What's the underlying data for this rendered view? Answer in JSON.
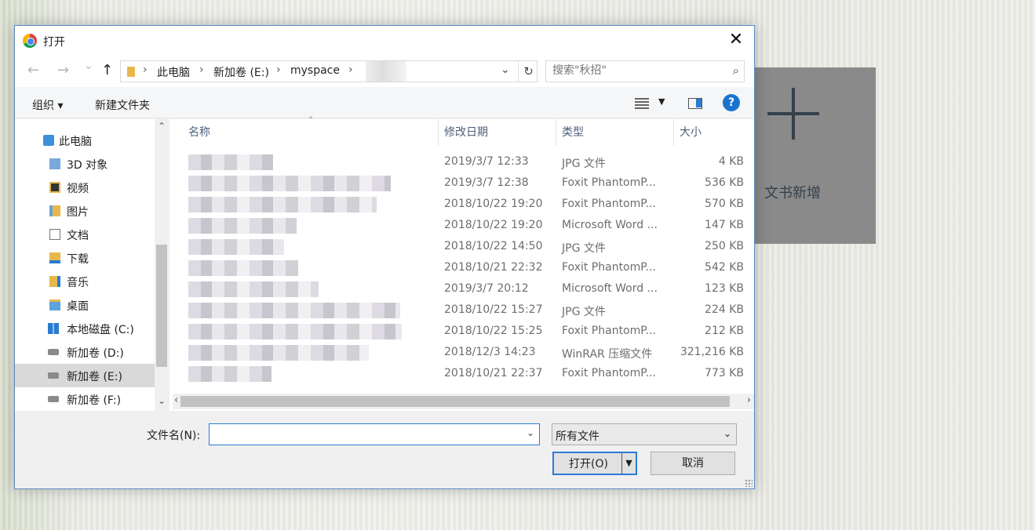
{
  "background_card": {
    "label": "文书新增",
    "icon": "plus-icon"
  },
  "dialog": {
    "title": "打开",
    "title_icon": "chrome-icon",
    "nav": {
      "back": "←",
      "forward": "→",
      "recent": "⌄",
      "up": "↑",
      "breadcrumb": [
        "此电脑",
        "新加卷 (E:)",
        "myspace"
      ],
      "separator": "›",
      "search_placeholder": "搜索\"秋招\""
    },
    "toolbar": {
      "organize": "组织 ▾",
      "new_folder": "新建文件夹"
    },
    "tree": [
      {
        "label": "此电脑",
        "icon": "computer-icon"
      },
      {
        "label": "3D 对象",
        "icon": "3d-objects-icon"
      },
      {
        "label": "视频",
        "icon": "video-folder-icon"
      },
      {
        "label": "图片",
        "icon": "pictures-folder-icon"
      },
      {
        "label": "文档",
        "icon": "documents-folder-icon"
      },
      {
        "label": "下载",
        "icon": "downloads-folder-icon"
      },
      {
        "label": "音乐",
        "icon": "music-folder-icon"
      },
      {
        "label": "桌面",
        "icon": "desktop-folder-icon"
      },
      {
        "label": "本地磁盘 (C:)",
        "icon": "windows-drive-icon"
      },
      {
        "label": "新加卷 (D:)",
        "icon": "drive-icon"
      },
      {
        "label": "新加卷 (E:)",
        "icon": "drive-icon",
        "selected": true
      },
      {
        "label": "新加卷 (F:)",
        "icon": "drive-icon"
      }
    ],
    "columns": {
      "name": "名称",
      "date": "修改日期",
      "type": "类型",
      "size": "大小"
    },
    "files": [
      {
        "date": "2019/3/7 12:33",
        "type": "JPG 文件",
        "size": "4 KB"
      },
      {
        "date": "2019/3/7 12:38",
        "type": "Foxit PhantomP...",
        "size": "536 KB"
      },
      {
        "date": "2018/10/22 19:20",
        "type": "Foxit PhantomP...",
        "size": "570 KB"
      },
      {
        "date": "2018/10/22 19:20",
        "type": "Microsoft Word ...",
        "size": "147 KB"
      },
      {
        "date": "2018/10/22 14:50",
        "type": "JPG 文件",
        "size": "250 KB"
      },
      {
        "date": "2018/10/21 22:32",
        "type": "Foxit PhantomP...",
        "size": "542 KB"
      },
      {
        "date": "2019/3/7 20:12",
        "type": "Microsoft Word ...",
        "size": "123 KB"
      },
      {
        "date": "2018/10/22 15:27",
        "type": "JPG 文件",
        "size": "224 KB"
      },
      {
        "date": "2018/10/22 15:25",
        "type": "Foxit PhantomP...",
        "size": "212 KB"
      },
      {
        "date": "2018/12/3 14:23",
        "type": "WinRAR 压缩文件",
        "size": "321,216 KB"
      },
      {
        "date": "2018/10/21 22:37",
        "type": "Foxit PhantomP...",
        "size": "773 KB"
      }
    ],
    "filename_label": "文件名(N):",
    "filename_value": "",
    "filetype": "所有文件",
    "open_button": "打开(O)",
    "cancel_button": "取消",
    "colors": {
      "accent": "#2a7bd3",
      "selected_row": "#d9d9d9"
    }
  }
}
